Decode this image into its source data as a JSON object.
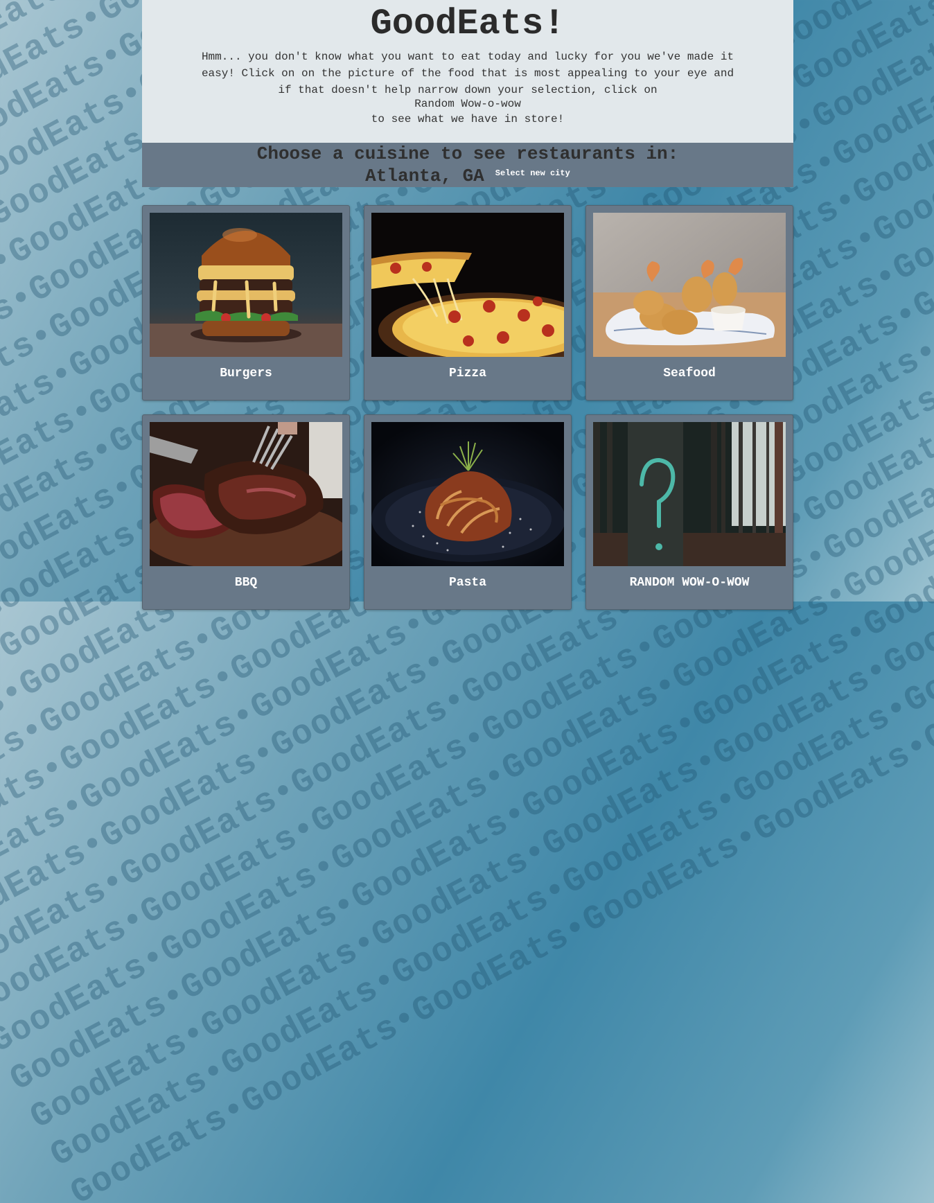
{
  "site": {
    "title": "GoodEats!",
    "intro": "Hmm... you don't know what you want to eat today and lucky for you we've made it easy! Click on on the picture of the food that is most appealing to your eye and if that doesn't help narrow down your selection, click on",
    "random_text": "Random Wow-o-wow",
    "outro": "to see what we have in store!"
  },
  "banner": {
    "heading": "Choose a cuisine to see restaurants in:",
    "city": "Atlanta, GA",
    "select_city_label": "Select new city"
  },
  "background_text": "GoodEats•GoodEats•GoodEats•GoodEats•GoodEats•GoodEats•GoodEats•GoodEats•",
  "cards": [
    {
      "label": "Burgers",
      "icon": "burger-photo"
    },
    {
      "label": "Pizza",
      "icon": "pizza-photo"
    },
    {
      "label": "Seafood",
      "icon": "seafood-photo"
    },
    {
      "label": "BBQ",
      "icon": "bbq-photo"
    },
    {
      "label": "Pasta",
      "icon": "pasta-photo"
    },
    {
      "label": "RANDOM WOW-O-WOW",
      "icon": "question-mark-tree-photo"
    }
  ],
  "colors": {
    "hero_bg": "#e2e8eb",
    "banner_bg": "#687888",
    "card_bg": "#687888",
    "card_text": "#ffffff"
  }
}
